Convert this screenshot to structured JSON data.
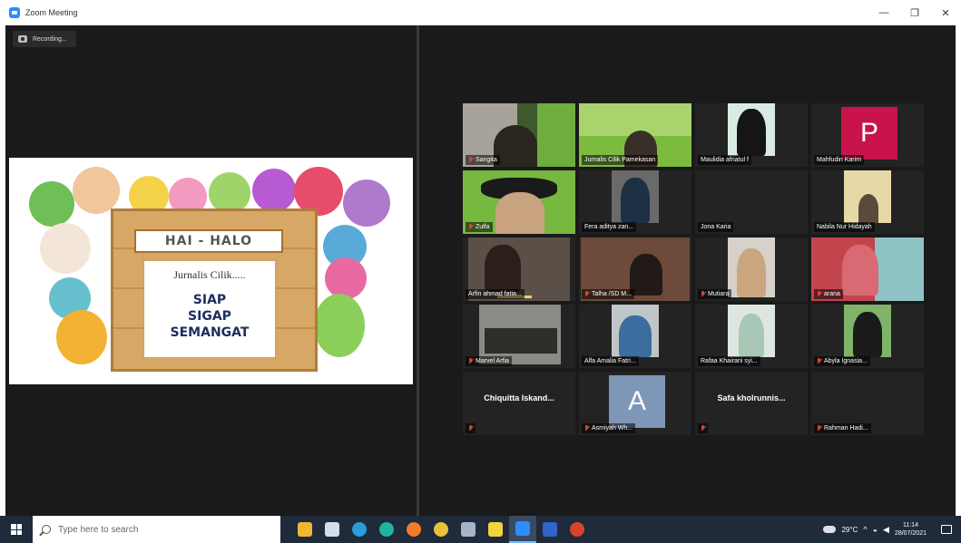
{
  "window": {
    "title": "Zoom Meeting",
    "minimize": "—",
    "maximize": "❐",
    "close": "✕"
  },
  "recording": {
    "label": "Recording..."
  },
  "slide": {
    "banner": "HAI - HALO",
    "subtitle": "Jurnalis Cilik.....",
    "lines": [
      "SIAP",
      "SIGAP",
      "SEMANGAT"
    ]
  },
  "participants": [
    {
      "name": "Sangita",
      "muted": true
    },
    {
      "name": "Jurnalis Cilik Pamekasan",
      "muted": false
    },
    {
      "name": "Maulidia afriatul f",
      "muted": false
    },
    {
      "name": "Mahfudin Karim",
      "muted": false,
      "avatar_letter": "P"
    },
    {
      "name": "Zulfa",
      "muted": true
    },
    {
      "name": "Fera aditya zan...",
      "muted": false
    },
    {
      "name": "Jona Karia",
      "muted": false
    },
    {
      "name": "Nabila Nur Hidayah",
      "muted": false
    },
    {
      "name": "Arfin ahmad fatia...",
      "muted": false
    },
    {
      "name": "Talha /SD M...",
      "muted": true
    },
    {
      "name": "Mutiara",
      "muted": true
    },
    {
      "name": "arana",
      "muted": true
    },
    {
      "name": "Marvel Arfia",
      "muted": true
    },
    {
      "name": "Alfa Amalia Fatri...",
      "muted": false
    },
    {
      "name": "Rafaa Khairani syi...",
      "muted": false
    },
    {
      "name": "Abyla Ignasia...",
      "muted": true
    },
    {
      "name": "Chiquitta Iskand...",
      "muted": true,
      "text_only": true
    },
    {
      "name": "Asmiyah Wh...",
      "muted": true,
      "avatar_letter": "A"
    },
    {
      "name": "Safa kholrunnis...",
      "muted": true,
      "text_only": true
    },
    {
      "name": "Rahman Hadi...",
      "muted": true
    }
  ],
  "taskbar": {
    "search_placeholder": "Type here to search",
    "weather": "29°C",
    "time": "11:14",
    "date": "28/07/2021"
  },
  "colors": {
    "accent": "#2d8cff",
    "meeting_bg": "#1a1a1a",
    "taskbar_bg": "#1f2a3a",
    "avatar_p": "#c8134b",
    "avatar_a": "#7e97b6"
  }
}
